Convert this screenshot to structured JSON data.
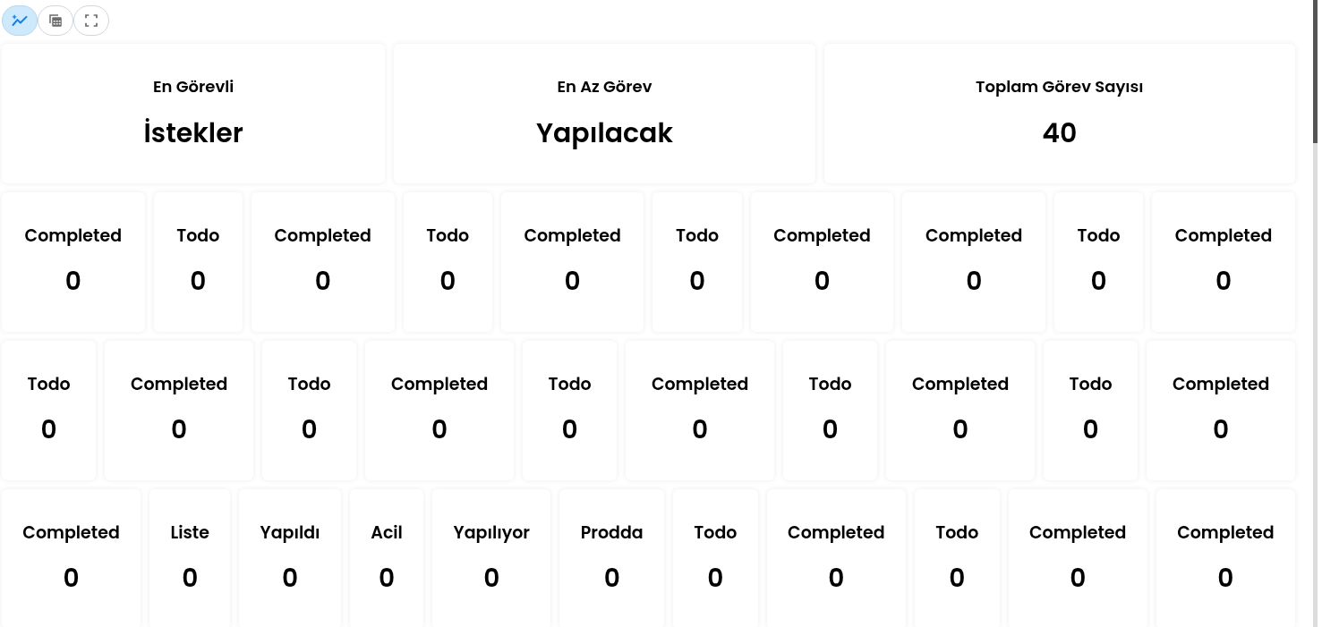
{
  "toolbar": [
    {
      "kind": "chart",
      "selected": true
    },
    {
      "kind": "table",
      "selected": false
    },
    {
      "kind": "fullscreen",
      "selected": false
    }
  ],
  "summary": [
    {
      "label": "En Görevli",
      "value": "İstekler"
    },
    {
      "label": "En Az Görev",
      "value": "Yapılacak"
    },
    {
      "label": "Toplam Görev Sayısı",
      "value": "40"
    }
  ],
  "status_rows": [
    [
      {
        "label": "Completed",
        "value": "0"
      },
      {
        "label": "Todo",
        "value": "0"
      },
      {
        "label": "Completed",
        "value": "0"
      },
      {
        "label": "Todo",
        "value": "0"
      },
      {
        "label": "Completed",
        "value": "0"
      },
      {
        "label": "Todo",
        "value": "0"
      },
      {
        "label": "Completed",
        "value": "0"
      },
      {
        "label": "Completed",
        "value": "0"
      },
      {
        "label": "Todo",
        "value": "0"
      },
      {
        "label": "Completed",
        "value": "0"
      }
    ],
    [
      {
        "label": "Todo",
        "value": "0"
      },
      {
        "label": "Completed",
        "value": "0"
      },
      {
        "label": "Todo",
        "value": "0"
      },
      {
        "label": "Completed",
        "value": "0"
      },
      {
        "label": "Todo",
        "value": "0"
      },
      {
        "label": "Completed",
        "value": "0"
      },
      {
        "label": "Todo",
        "value": "0"
      },
      {
        "label": "Completed",
        "value": "0"
      },
      {
        "label": "Todo",
        "value": "0"
      },
      {
        "label": "Completed",
        "value": "0"
      }
    ],
    [
      {
        "label": "Completed",
        "value": "0"
      },
      {
        "label": "Liste",
        "value": "0"
      },
      {
        "label": "Yapıldı",
        "value": "0"
      },
      {
        "label": "Acil",
        "value": "0"
      },
      {
        "label": "Yapılıyor",
        "value": "0"
      },
      {
        "label": "Prodda",
        "value": "0"
      },
      {
        "label": "Todo",
        "value": "0"
      },
      {
        "label": "Completed",
        "value": "0"
      },
      {
        "label": "Todo",
        "value": "0"
      },
      {
        "label": "Completed",
        "value": "0"
      },
      {
        "label": "Completed",
        "value": "0"
      }
    ]
  ]
}
